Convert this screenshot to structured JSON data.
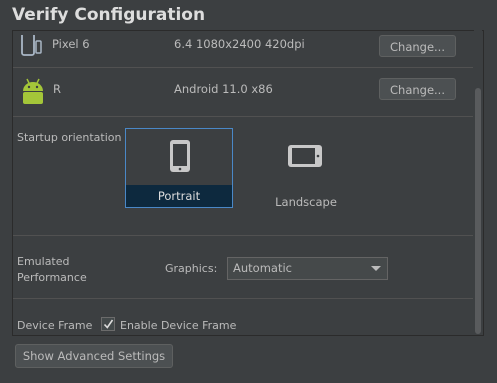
{
  "dialog": {
    "title": "Verify Configuration"
  },
  "device": {
    "name": "Pixel 6",
    "spec": "6.4 1080x2400 420dpi",
    "change_label": "Change..."
  },
  "system_image": {
    "name": "R",
    "spec": "Android 11.0 x86",
    "change_label": "Change..."
  },
  "orientation": {
    "label": "Startup orientation",
    "options": [
      {
        "label": "Portrait",
        "selected": true
      },
      {
        "label": "Landscape",
        "selected": false
      }
    ]
  },
  "performance": {
    "label_line1": "Emulated",
    "label_line2": "Performance",
    "graphics_label": "Graphics:",
    "graphics_value": "Automatic"
  },
  "device_frame": {
    "label": "Device Frame",
    "checkbox_label": "Enable Device Frame",
    "checked": true
  },
  "advanced_button": "Show Advanced Settings",
  "colors": {
    "background": "#3c3f41",
    "selection": "#0d293e",
    "android_green": "#a4c639",
    "focus_border": "#4a88c7"
  },
  "icons": [
    "phone-icon",
    "android-icon",
    "portrait-phone-icon",
    "landscape-phone-icon",
    "check-icon",
    "dropdown-caret-icon"
  ]
}
